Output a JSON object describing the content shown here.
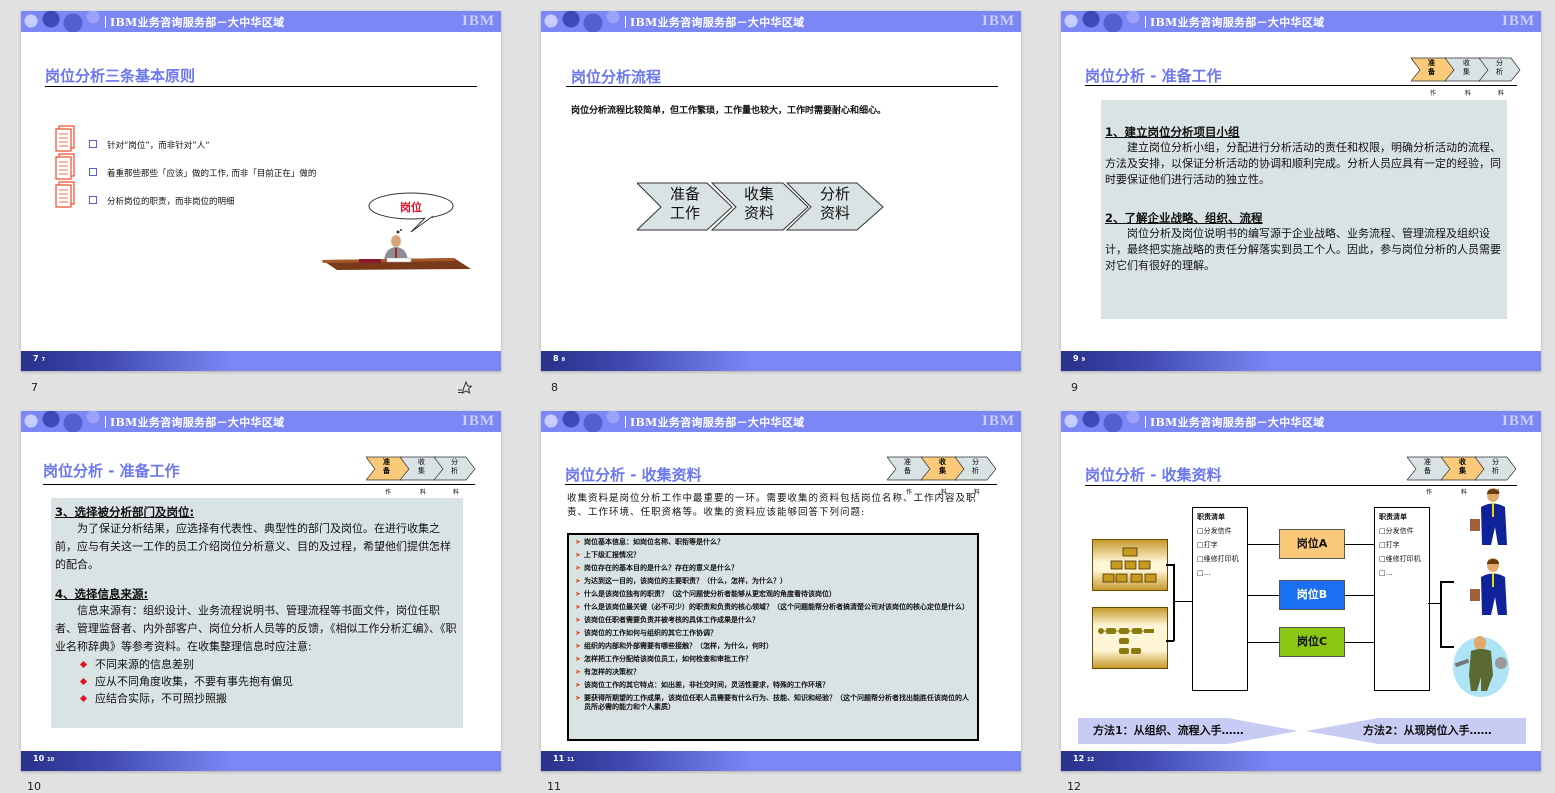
{
  "header": {
    "org_text": "IBM业务咨询服务部－大中华区域",
    "logo": "IBM"
  },
  "slides": [
    {
      "number": "7",
      "footer_num": "7",
      "title": "岗位分析三条基本原则",
      "bullets": [
        "针对“岗位”，而非针对”人“",
        "着重那些那些「应该」做的工作, 而非「目前正在」做的",
        "分析岗位的职责，而非岗位的明细"
      ],
      "bubble_text": "岗位",
      "icons": {
        "bullet": "checkbox-icon",
        "doc": "document-stack-icon",
        "illustration": "thinking-man-at-desk"
      },
      "starred_icon": "star-icon"
    },
    {
      "number": "8",
      "footer_num": "8",
      "title": "岗位分析流程",
      "intro": "岗位分析流程比较简单，但工作繁琐，工作量也较大，工作时需要耐心和细心。",
      "steps": [
        {
          "line1": "准备",
          "line2": "工作"
        },
        {
          "line1": "收集",
          "line2": "资料"
        },
        {
          "line1": "分析",
          "line2": "资料"
        }
      ]
    },
    {
      "number": "9",
      "footer_num": "9",
      "title": "岗位分析 - 准备工作",
      "progress": [
        "准备",
        "收集",
        "分析"
      ],
      "progress_sub": [
        "作",
        "料",
        "料"
      ],
      "active_step": 0,
      "sections": [
        {
          "heading": "1、建立岗位分析项目小组",
          "text": "建立岗位分析小组，分配进行分析活动的责任和权限，明确分析活动的流程、方法及安排，以保证分析活动的协调和顺利完成。分析人员应具有一定的经验，同时要保证他们进行活动的独立性。"
        },
        {
          "heading": "2、了解企业战略、组织、流程",
          "text": "岗位分析及岗位说明书的编写源于企业战略、业务流程、管理流程及组织设计，最终把实施战略的责任分解落实到员工个人。因此，参与岗位分析的人员需要对它们有很好的理解。"
        }
      ]
    },
    {
      "number": "10",
      "footer_num": "10",
      "title": "岗位分析 - 准备工作",
      "progress": [
        "准备",
        "收集",
        "分析"
      ],
      "progress_sub": [
        "作",
        "料",
        "料"
      ],
      "active_step": 0,
      "sections": [
        {
          "heading": "3、选择被分析部门及岗位:",
          "text": "为了保证分析结果，应选择有代表性、典型性的部门及岗位。在进行收集之前，应与有关这一工作的员工介绍岗位分析意义、目的及过程，希望他们提供怎样的配合。"
        },
        {
          "heading": "4、选择信息来源:",
          "text": "信息来源有：组织设计、业务流程说明书、管理流程等书面文件，岗位任职者、管理监督者、内外部客户、岗位分析人员等的反馈，《相似工作分析汇编》、《职业名称辞典》等参考资料。在收集整理信息时应注意:"
        }
      ],
      "notes": [
        "不同来源的信息差别",
        "应从不同角度收集，不要有事先抱有偏见",
        "应结合实际，不可照抄照搬"
      ]
    },
    {
      "number": "11",
      "footer_num": "11",
      "title": "岗位分析 - 收集资料",
      "progress": [
        "准备",
        "收集",
        "分析"
      ],
      "progress_sub": [
        "作",
        "料",
        "料"
      ],
      "active_step": 1,
      "intro": "收集资料是岗位分析工作中最重要的一环。需要收集的资料包括岗位名称、工作内容及职责、工作环境、任职资格等。收集的资料应该能够回答下列问题:",
      "questions": [
        "岗位基本信息：如岗位名称、职衔等是什么？",
        "上下级汇报情况？",
        "岗位存在的基本目的是什么？存在的意义是什么？",
        "为达到这一目的，该岗位的主要职责？（什么，怎样，为什么？）",
        "什么是该岗位独有的职责？（这个问题使分析者能够从更宏观的角度看待该岗位）",
        "什么是该岗位最关键（必不可少）的职责和负责的核心领域？（这个问题能帮分析者搞清楚公司对该岗位的核心定位是什么）",
        "该岗位任职者需要负责并被考核的具体工作成果是什么？",
        "该岗位的工作如何与组织的其它工作协调？",
        "组织的内部和外部需要有哪些接触？（怎样，为什么，何时）",
        "怎样把工作分配给该岗位员工，如何检查和审批工作？",
        "有怎样的决策权？",
        "该岗位工作的其它特点：如出差，非社交时间，灵活性要求，特殊的工作环境？",
        "要获得所期望的工作成果，该岗位任职人员需要有什么行为、技能、知识和经验？（这个问题帮分析者找出能胜任该岗位的人员所必需的能力和个人素质）"
      ]
    },
    {
      "number": "12",
      "footer_num": "12",
      "title": "岗位分析 - 收集资料",
      "progress": [
        "准备",
        "收集",
        "分析"
      ],
      "progress_sub": [
        "作",
        "料",
        "料"
      ],
      "active_step": 1,
      "duty_list": {
        "title": "职责清单",
        "items": [
          "□分发信件",
          "□打字",
          "□维修打印机",
          "□…"
        ]
      },
      "positions": [
        {
          "label": "岗位A",
          "color": "#fac97a",
          "text_color": "#111111"
        },
        {
          "label": "岗位B",
          "color": "#1a6ff2",
          "text_color": "#ffffff"
        },
        {
          "label": "岗位C",
          "color": "#8cc614",
          "text_color": "#111111"
        }
      ],
      "methods": [
        "方法1：从组织、流程入手……",
        "方法2：从现岗位入手……"
      ],
      "icons": {
        "org_chart": "org-chart-icon",
        "process": "process-flow-icon",
        "people": [
          "businessman-icon",
          "businessman-icon",
          "worker-icon"
        ]
      }
    }
  ],
  "colors": {
    "accent": "#7b87f5",
    "title": "#6b78f0",
    "panel": "#d9e3e4",
    "chevron_active": "#fac97a",
    "chevron_inactive": "#d9e3e4"
  }
}
